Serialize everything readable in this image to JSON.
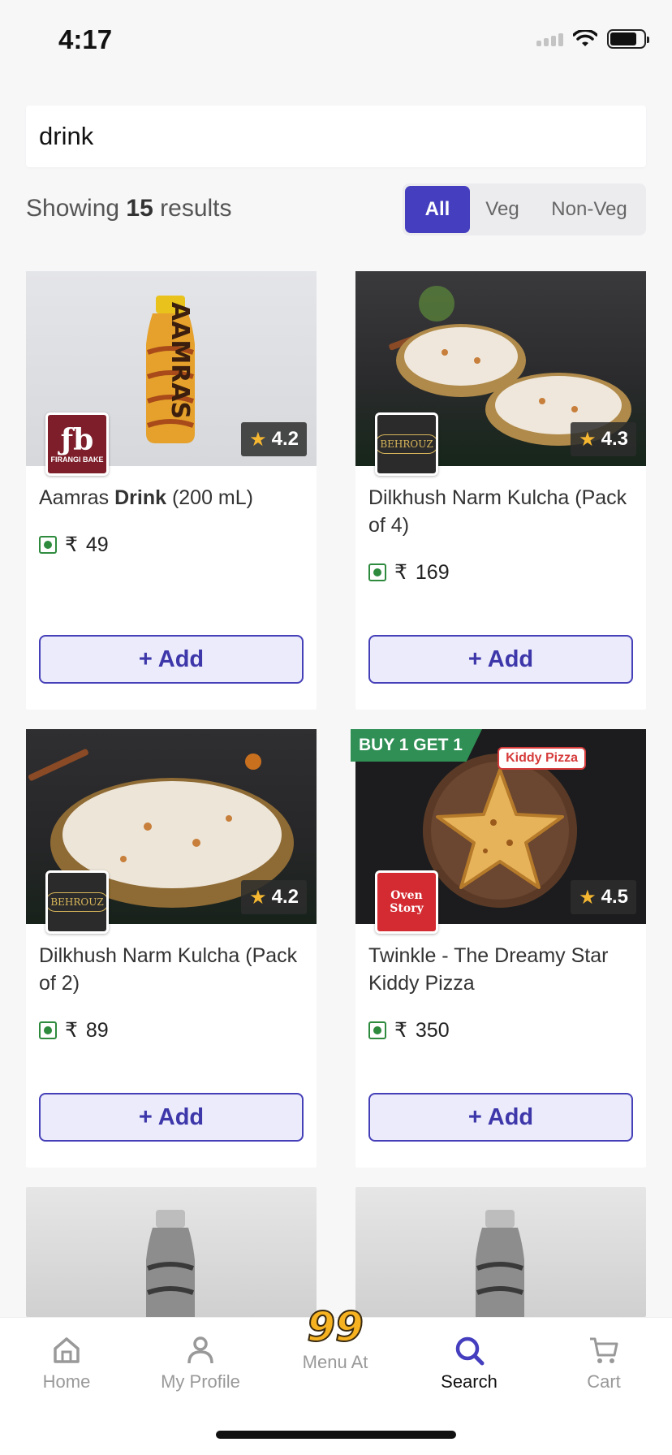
{
  "status_bar": {
    "time": "4:17"
  },
  "search": {
    "value": "drink",
    "placeholder": ""
  },
  "results": {
    "prefix": "Showing",
    "count": "15",
    "suffix": "results"
  },
  "filters": {
    "all": "All",
    "veg": "Veg",
    "non_veg": "Non-Veg",
    "selected": "All"
  },
  "products": [
    {
      "title_plain_1": "Aamras ",
      "title_bold": "Drink",
      "title_plain_2": " (200 mL)",
      "currency": "₹",
      "price": "49",
      "rating": "4.2",
      "brand": "FIRANGI BAKE",
      "add_label": "+ Add"
    },
    {
      "title_plain_1": "Dilkhush Narm Kulcha (Pack of 4)",
      "title_bold": "",
      "title_plain_2": "",
      "currency": "₹",
      "price": "169",
      "rating": "4.3",
      "brand": "BEHROUZ",
      "add_label": "+ Add"
    },
    {
      "title_plain_1": "Dilkhush Narm Kulcha (Pack of 2)",
      "title_bold": "",
      "title_plain_2": "",
      "currency": "₹",
      "price": "89",
      "rating": "4.2",
      "brand": "BEHROUZ",
      "add_label": "+ Add"
    },
    {
      "title_plain_1": "Twinkle - The Dreamy Star Kiddy Pizza",
      "title_bold": "",
      "title_plain_2": "",
      "currency": "₹",
      "price": "350",
      "rating": "4.5",
      "brand": "Oven Story",
      "offer": "BUY 1 GET 1",
      "tag": "Kiddy Pizza",
      "add_label": "+ Add"
    }
  ],
  "bottom_nav": {
    "home": "Home",
    "profile": "My Profile",
    "menu": "Menu At",
    "menu_badge": "99",
    "search": "Search",
    "cart": "Cart",
    "active": "Search"
  },
  "colors": {
    "accent": "#453fbf",
    "veg": "#2e8b3e",
    "offer": "#2f8f55"
  }
}
